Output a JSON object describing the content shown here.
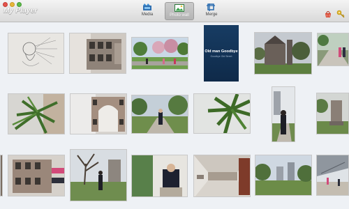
{
  "window": {
    "title": "My Player"
  },
  "tabs": [
    {
      "label": "Media",
      "icon": "film-icon",
      "active": false
    },
    {
      "label": "Photo wall",
      "icon": "photo-icon",
      "active": true
    },
    {
      "label": "Merge",
      "icon": "merge-icon",
      "active": false
    }
  ],
  "toolbar_icons": [
    "basket-icon",
    "key-icon"
  ],
  "book": {
    "title": "Old man Goodbye",
    "subtitle": "Goodbye Old Street"
  },
  "colors": {
    "accent": "#1a4a7a",
    "background": "#eef1f5"
  }
}
